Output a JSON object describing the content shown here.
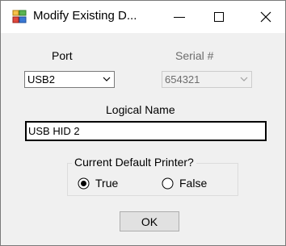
{
  "window": {
    "title": "Modify Existing D...",
    "icon": "printer-app-icon",
    "controls": [
      "minimize-icon",
      "maximize-icon",
      "close-icon"
    ]
  },
  "port": {
    "label": "Port",
    "selected": "USB2"
  },
  "serial": {
    "label": "Serial #",
    "selected": "654321",
    "enabled": false
  },
  "logical_name": {
    "label": "Logical Name",
    "value": "USB HID 2"
  },
  "default_printer": {
    "legend": "Current Default Printer?",
    "options": [
      {
        "label": "True",
        "checked": true
      },
      {
        "label": "False",
        "checked": false
      }
    ]
  },
  "ok_button": {
    "label": "OK"
  },
  "colors": {
    "window_bg": "#f0f0f0",
    "titlebar_bg": "#ffffff",
    "button_bg": "#e1e1e1",
    "disabled_text": "#6d6d6d"
  }
}
